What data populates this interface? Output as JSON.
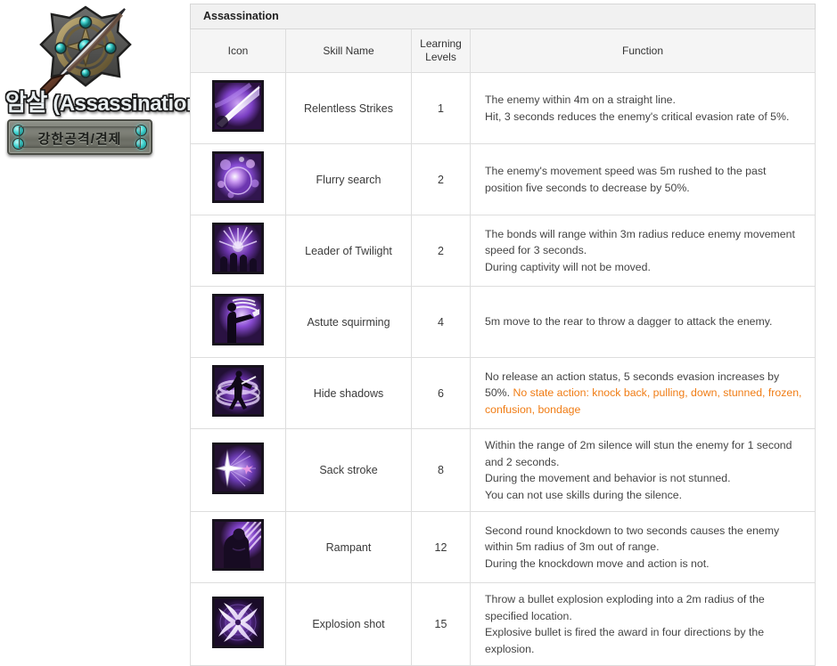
{
  "class_panel": {
    "emblem_name": "assassination-class-crest",
    "title_kr": "암살",
    "title_en": "(Assassination)",
    "role_plate_text": "강한공격/견제"
  },
  "table": {
    "caption": "Assassination",
    "columns": [
      "Icon",
      "Skill Name",
      "Learning Levels",
      "Function"
    ],
    "column_header_level_line1": "Learning",
    "column_header_level_line2": "Levels",
    "rows": [
      {
        "icon_name": "relentless-strikes-icon",
        "skill_name": "Relentless Strikes",
        "level": "1",
        "function_lines": [
          {
            "text": "The enemy within 4m on a straight line.",
            "highlight": false
          },
          {
            "text": "Hit, 3 seconds reduces the enemy's critical evasion rate of 5%.",
            "highlight": false
          }
        ]
      },
      {
        "icon_name": "flurry-search-icon",
        "skill_name": "Flurry search",
        "level": "2",
        "function_lines": [
          {
            "text": "The enemy's movement speed was 5m rushed to the past",
            "highlight": false
          },
          {
            "text": "position five seconds to decrease by 50%.",
            "highlight": false
          }
        ]
      },
      {
        "icon_name": "leader-of-twilight-icon",
        "skill_name": "Leader of Twilight",
        "level": "2",
        "function_lines": [
          {
            "text": "The bonds will range within 3m radius reduce enemy movement",
            "highlight": false
          },
          {
            "text": "speed for 3 seconds.",
            "highlight": false
          },
          {
            "text": "During captivity will not be moved.",
            "highlight": false
          }
        ]
      },
      {
        "icon_name": "astute-squirming-icon",
        "skill_name": "Astute squirming",
        "level": "4",
        "function_lines": [
          {
            "text": "5m move to the rear to throw a dagger to attack the enemy.",
            "highlight": false
          }
        ]
      },
      {
        "icon_name": "hide-shadows-icon",
        "skill_name": "Hide shadows",
        "level": "6",
        "function_lines": [
          {
            "text": "No release an action status, 5 seconds evasion increases by",
            "highlight": false
          },
          {
            "text": "50%. ",
            "highlight": false,
            "inline_next": true
          },
          {
            "text": "No state action: knock back, pulling, down, stunned, frozen, confusion, bondage",
            "highlight": true
          }
        ]
      },
      {
        "icon_name": "sack-stroke-icon",
        "skill_name": "Sack stroke",
        "level": "8",
        "function_lines": [
          {
            "text": "Within the range of 2m silence will stun the enemy for 1 second",
            "highlight": false
          },
          {
            "text": "and 2 seconds.",
            "highlight": false
          },
          {
            "text": "During the movement and behavior is not stunned.",
            "highlight": false
          },
          {
            "text": "You can not use skills during the silence.",
            "highlight": false
          }
        ]
      },
      {
        "icon_name": "rampant-icon",
        "skill_name": "Rampant",
        "level": "12",
        "function_lines": [
          {
            "text": "Second round knockdown to two seconds causes the enemy",
            "highlight": false
          },
          {
            "text": "within 5m radius of 3m out of range.",
            "highlight": false
          },
          {
            "text": "During the knockdown move and action is not.",
            "highlight": false
          }
        ]
      },
      {
        "icon_name": "explosion-shot-icon",
        "skill_name": "Explosion shot",
        "level": "15",
        "function_lines": [
          {
            "text": "Throw a bullet explosion exploding into a 2m radius of the",
            "highlight": false
          },
          {
            "text": "specified location.",
            "highlight": false
          },
          {
            "text": "Explosive bullet is fired the award in four directions by the",
            "highlight": false
          },
          {
            "text": "explosion.",
            "highlight": false
          }
        ]
      }
    ]
  },
  "colors": {
    "highlight_orange": "#f07c14",
    "header_bg": "#f1f1f1",
    "border": "#dddddd",
    "body_text": "#444444",
    "gem_teal": "#3fd2cf"
  }
}
